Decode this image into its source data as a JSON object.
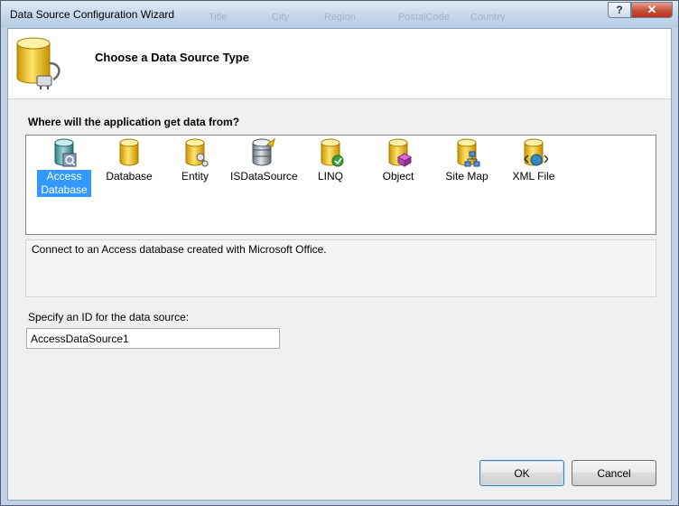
{
  "window": {
    "title": "Data Source Configuration Wizard",
    "ghost_columns": [
      "Title",
      "City",
      "Region",
      "PostalCode",
      "Country"
    ],
    "help_label": "?",
    "close_label": "✕"
  },
  "header": {
    "title": "Choose a Data Source Type"
  },
  "question": "Where will the application get data from?",
  "source_types": [
    {
      "label": "Access Database",
      "icon": "access-database-icon",
      "selected": true
    },
    {
      "label": "Database",
      "icon": "database-icon",
      "selected": false
    },
    {
      "label": "Entity",
      "icon": "entity-icon",
      "selected": false
    },
    {
      "label": "ISDataSource",
      "icon": "isdatasource-icon",
      "selected": false
    },
    {
      "label": "LINQ",
      "icon": "linq-icon",
      "selected": false
    },
    {
      "label": "Object",
      "icon": "object-icon",
      "selected": false
    },
    {
      "label": "Site Map",
      "icon": "site-map-icon",
      "selected": false
    },
    {
      "label": "XML File",
      "icon": "xml-file-icon",
      "selected": false
    }
  ],
  "description": "Connect to an Access database created with Microsoft Office.",
  "id_field": {
    "label": "Specify an ID for the data source:",
    "value": "AccessDataSource1"
  },
  "buttons": {
    "ok": "OK",
    "cancel": "Cancel"
  },
  "colors": {
    "selection": "#3399ff",
    "cylinder": "#f2c200",
    "close": "#c84d36"
  }
}
